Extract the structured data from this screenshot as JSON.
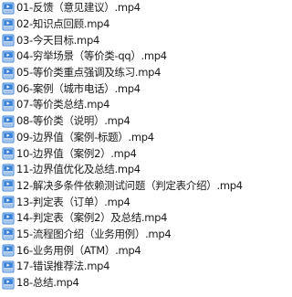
{
  "files": [
    {
      "name": "01-反馈（意见建议）.mp4"
    },
    {
      "name": "02-知识点回顾.mp4"
    },
    {
      "name": "03-今天目标.mp4"
    },
    {
      "name": "04-穷举场景（等价类-qq）.mp4"
    },
    {
      "name": "05-等价类重点强调及练习.mp4"
    },
    {
      "name": "06-案例（城市电话）.mp4"
    },
    {
      "name": "07-等价类总结.mp4"
    },
    {
      "name": "08-等价类（说明）.mp4"
    },
    {
      "name": "09-边界值（案例-标题）.mp4"
    },
    {
      "name": "10-边界值（案例2）.mp4"
    },
    {
      "name": "11-边界值优化及总结.mp4"
    },
    {
      "name": "12-解决多条件依赖测试问题（判定表介绍）.mp4"
    },
    {
      "name": "13-判定表（订单）.mp4"
    },
    {
      "name": "14-判定表（案例2）及总结.mp4"
    },
    {
      "name": "15-流程图介绍（业务用例）.mp4"
    },
    {
      "name": "16-业务用例（ATM）.mp4"
    },
    {
      "name": "17-错误推荐法.mp4"
    },
    {
      "name": "18-总结.mp4"
    }
  ],
  "icon": "video-file-icon",
  "colors": {
    "icon_blue": "#3b82d6",
    "icon_light": "#dbe8f7",
    "text": "#1a1a1a"
  }
}
